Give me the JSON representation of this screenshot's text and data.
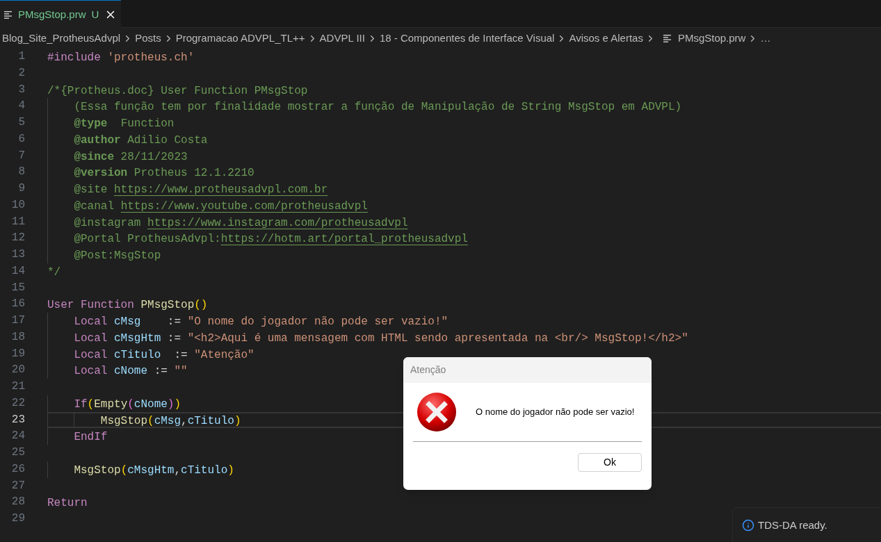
{
  "tabs": [
    {
      "label": "PMsgStop.prw",
      "badge": "U",
      "selected": true
    }
  ],
  "breadcrumbs": [
    {
      "label": "Blog_Site_ProtheusAdvpl",
      "kind": "folder"
    },
    {
      "label": "Posts",
      "kind": "folder"
    },
    {
      "label": "Programacao ADVPL_TL++",
      "kind": "folder"
    },
    {
      "label": "ADVPL III",
      "kind": "folder"
    },
    {
      "label": "18 - Componentes de Interface Visual",
      "kind": "folder"
    },
    {
      "label": "Avisos e Alertas",
      "kind": "folder"
    },
    {
      "label": "PMsgStop.prw",
      "kind": "file"
    },
    {
      "label": "…",
      "kind": "more"
    }
  ],
  "code_lines": [
    {
      "number": "1",
      "current": false,
      "tokens": [
        {
          "kind": "kw",
          "text": "#include"
        },
        {
          "kind": "str",
          "text": " 'protheus.ch'"
        }
      ]
    },
    {
      "number": "2",
      "current": false
    },
    {
      "number": "3",
      "current": false,
      "tokens": [
        {
          "kind": "cmt",
          "text": "/*{Protheus.doc} User Function PMsgStop"
        }
      ]
    },
    {
      "number": "4",
      "current": false,
      "tokens": [
        {
          "kind": "cmt",
          "text": "    (Essa função tem por finalidade mostrar a função de Manipulação de String MsgStop em ADVPL)"
        }
      ]
    },
    {
      "number": "5",
      "current": false,
      "tokens": [
        {
          "kind": "tag",
          "text": "    @type"
        },
        {
          "kind": "cmt",
          "text": "  Function"
        }
      ]
    },
    {
      "number": "6",
      "current": false,
      "tokens": [
        {
          "kind": "tag",
          "text": "    @author"
        },
        {
          "kind": "cmt",
          "text": " Adilio Costa"
        }
      ]
    },
    {
      "number": "7",
      "current": false,
      "tokens": [
        {
          "kind": "tag",
          "text": "    @since"
        },
        {
          "kind": "cmt",
          "text": " 28/11/2023"
        }
      ]
    },
    {
      "number": "8",
      "current": false,
      "tokens": [
        {
          "kind": "tag",
          "text": "    @version"
        },
        {
          "kind": "cmt",
          "text": " Protheus 12.1.2210"
        }
      ]
    },
    {
      "number": "9",
      "current": false,
      "tokens": [
        {
          "kind": "cmt",
          "text": "    @site "
        },
        {
          "kind": "link",
          "text": "https://www.protheusadvpl.com.br"
        }
      ]
    },
    {
      "number": "10",
      "current": false,
      "tokens": [
        {
          "kind": "cmt",
          "text": "    @canal "
        },
        {
          "kind": "link",
          "text": "https://www.youtube.com/protheusadvpl"
        }
      ]
    },
    {
      "number": "11",
      "current": false,
      "tokens": [
        {
          "kind": "cmt",
          "text": "    @instagram "
        },
        {
          "kind": "link",
          "text": "https://www.instagram.com/protheusadvpl"
        }
      ]
    },
    {
      "number": "12",
      "current": false,
      "tokens": [
        {
          "kind": "cmt",
          "text": "    @Portal ProtheusAdvpl:"
        },
        {
          "kind": "link",
          "text": "https://hotm.art/portal_protheusadvpl"
        }
      ]
    },
    {
      "number": "13",
      "current": false,
      "tokens": [
        {
          "kind": "cmt",
          "text": "    @Post:MsgStop"
        }
      ]
    },
    {
      "number": "14",
      "current": false,
      "tokens": [
        {
          "kind": "cmt",
          "text": "*/"
        }
      ]
    },
    {
      "number": "15",
      "current": false
    },
    {
      "number": "16",
      "current": false,
      "tokens": [
        {
          "kind": "kw",
          "text": "User Function "
        },
        {
          "kind": "fn",
          "text": "PMsgStop"
        },
        {
          "kind": "b1",
          "text": "()"
        }
      ]
    },
    {
      "number": "17",
      "current": false,
      "tokens": [
        {
          "kind": "kw",
          "text": "    Local "
        },
        {
          "kind": "var",
          "text": "cMsg"
        },
        {
          "kind": "op",
          "text": "    := "
        },
        {
          "kind": "str",
          "text": "\"O nome do jogador não pode ser vazio!\""
        }
      ]
    },
    {
      "number": "18",
      "current": false,
      "tokens": [
        {
          "kind": "kw",
          "text": "    Local "
        },
        {
          "kind": "var",
          "text": "cMsgHtm"
        },
        {
          "kind": "op",
          "text": " := "
        },
        {
          "kind": "str",
          "text": "\"<h2>Aqui é uma mensagem com HTML sendo apresentada na <br/> MsgStop!</h2>\""
        }
      ]
    },
    {
      "number": "19",
      "current": false,
      "tokens": [
        {
          "kind": "kw",
          "text": "    Local "
        },
        {
          "kind": "var",
          "text": "cTitulo"
        },
        {
          "kind": "op",
          "text": "  := "
        },
        {
          "kind": "str",
          "text": "\"Atenção\""
        }
      ]
    },
    {
      "number": "20",
      "current": false,
      "tokens": [
        {
          "kind": "kw",
          "text": "    Local "
        },
        {
          "kind": "var",
          "text": "cNome"
        },
        {
          "kind": "op",
          "text": " := "
        },
        {
          "kind": "str",
          "text": "\"\""
        }
      ]
    },
    {
      "number": "21",
      "current": false
    },
    {
      "number": "22",
      "current": false,
      "tokens": [
        {
          "kind": "kw",
          "text": "    If"
        },
        {
          "kind": "b1",
          "text": "("
        },
        {
          "kind": "fn",
          "text": "Empty"
        },
        {
          "kind": "b2",
          "text": "("
        },
        {
          "kind": "var",
          "text": "cNome"
        },
        {
          "kind": "b2",
          "text": ")"
        },
        {
          "kind": "b1",
          "text": ")"
        }
      ]
    },
    {
      "number": "23",
      "current": true,
      "tokens": [
        {
          "kind": "fn",
          "text": "        MsgStop"
        },
        {
          "kind": "b1",
          "text": "("
        },
        {
          "kind": "var",
          "text": "cMsg"
        },
        {
          "kind": "op",
          "text": ","
        },
        {
          "kind": "var",
          "text": "cTitulo"
        },
        {
          "kind": "b1",
          "text": ")"
        }
      ]
    },
    {
      "number": "24",
      "current": false,
      "tokens": [
        {
          "kind": "kw",
          "text": "    EndIf"
        }
      ]
    },
    {
      "number": "25",
      "current": false
    },
    {
      "number": "26",
      "current": false,
      "tokens": [
        {
          "kind": "fn",
          "text": "    MsgStop"
        },
        {
          "kind": "b1",
          "text": "("
        },
        {
          "kind": "var",
          "text": "cMsgHtm"
        },
        {
          "kind": "op",
          "text": ","
        },
        {
          "kind": "var",
          "text": "cTitulo"
        },
        {
          "kind": "b1",
          "text": ")"
        }
      ]
    },
    {
      "number": "27",
      "current": false
    },
    {
      "number": "28",
      "current": false,
      "tokens": [
        {
          "kind": "kw",
          "text": "Return"
        }
      ]
    },
    {
      "number": "29",
      "current": false
    }
  ],
  "dialog": {
    "title": "Atenção",
    "message": "O nome do jogador não pode ser vazio!",
    "button": "Ok"
  },
  "notification": {
    "message": "TDS-DA ready."
  }
}
